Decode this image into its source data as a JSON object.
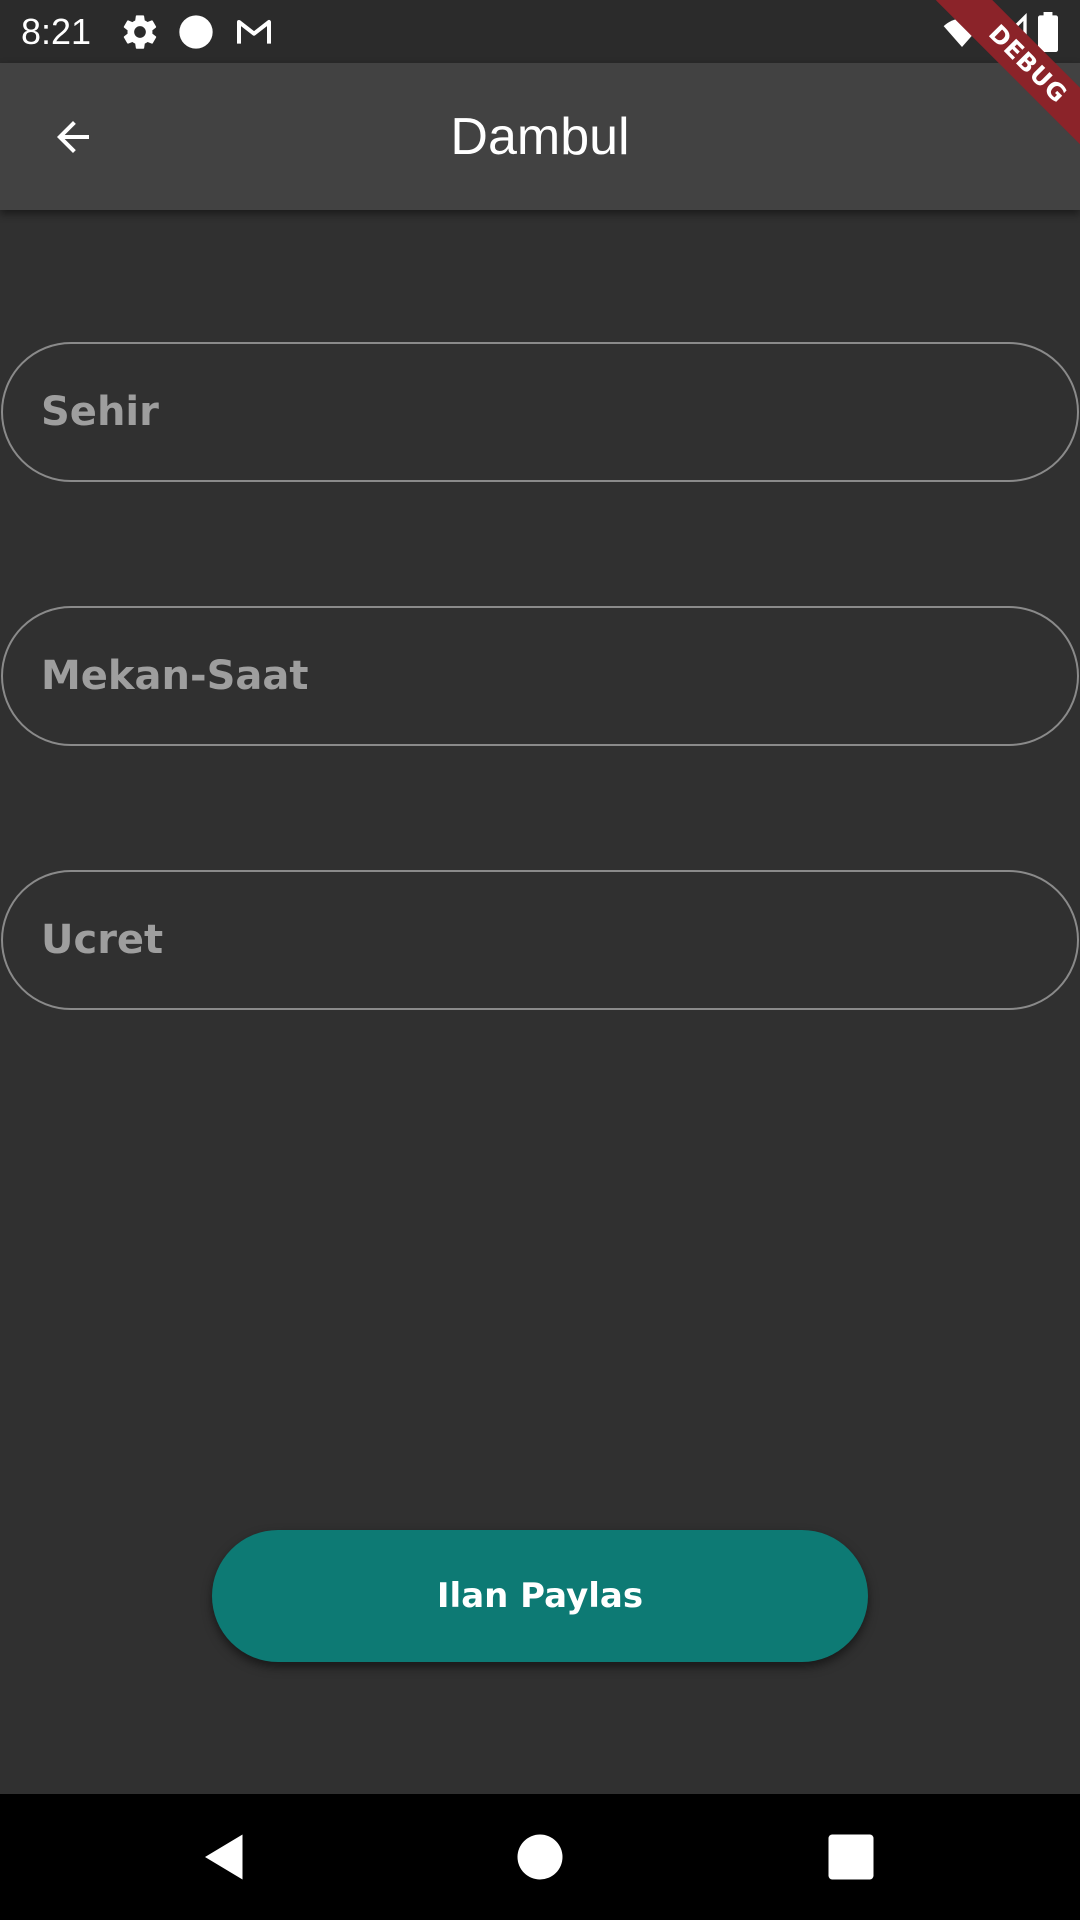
{
  "status_bar": {
    "time": "8:21",
    "icons": [
      "gear-icon",
      "circle-icon",
      "gmail-icon",
      "wifi-icon",
      "signal-icon",
      "battery-icon"
    ]
  },
  "debug_banner": "DEBUG",
  "app_bar": {
    "title": "Dambul",
    "back_icon": "arrow-back-icon"
  },
  "form": {
    "city": {
      "placeholder": "Sehir",
      "value": ""
    },
    "place_time": {
      "placeholder": "Mekan-Saat",
      "value": ""
    },
    "fee": {
      "placeholder": "Ucret",
      "value": ""
    }
  },
  "submit_label": "Ilan Paylas",
  "nav_bar": {
    "icons": [
      "back-triangle-icon",
      "home-circle-icon",
      "recents-square-icon"
    ]
  },
  "colors": {
    "background": "#303030",
    "app_bar": "#424242",
    "accent": "#0d7a74",
    "debug": "#8b2329"
  }
}
